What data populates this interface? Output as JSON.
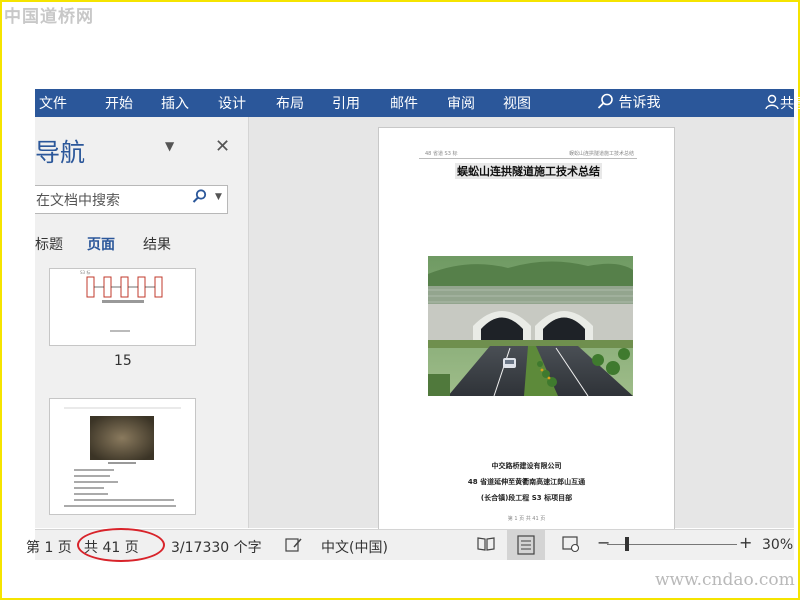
{
  "watermarks": {
    "top_left": "中国道桥网",
    "bottom_right": "www.cndao.com"
  },
  "ribbon": {
    "tabs": [
      "文件",
      "开始",
      "插入",
      "设计",
      "布局",
      "引用",
      "邮件",
      "审阅",
      "视图"
    ],
    "tell_me": "告诉我",
    "share": "共享(S"
  },
  "nav_pane": {
    "title": "导航",
    "search_placeholder": "在文档中搜索",
    "tabs": [
      "标题",
      "页面",
      "结果"
    ],
    "active_tab": "页面",
    "page_numbers": [
      "15"
    ]
  },
  "document": {
    "header_left": "48 省道 S3 标",
    "header_right": "蜈蚣山连拱隧道施工技术总结",
    "title": "蜈蚣山连拱隧道施工技术总结",
    "company_lines": [
      "中交路桥建设有限公司",
      "48 省道延伸至黄衢南高速江郎山互通",
      "(长合镇)段工程 S3 标项目部"
    ],
    "footer": "第 1 页 共 41 页"
  },
  "status_bar": {
    "page_of": "第 1 页",
    "total_pages": "共 41 页",
    "word_count": "3/17330 个字",
    "language": "中文(中国)",
    "zoom": "30%"
  },
  "colors": {
    "ribbon": "#2b579a",
    "highlight_circle": "#d8232a",
    "frame": "#f5e400"
  }
}
